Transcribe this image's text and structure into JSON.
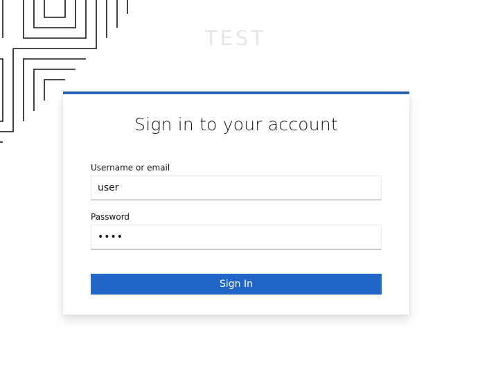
{
  "realm": {
    "name": "TEST"
  },
  "login": {
    "title": "Sign in to your account",
    "username_label": "Username or email",
    "username_value": "user",
    "password_label": "Password",
    "password_value": "••••",
    "submit_label": "Sign In"
  },
  "theme": {
    "accent": "#2b64b4",
    "button": "#2165c7"
  },
  "icons": {
    "background": "line-pattern-decoration"
  }
}
